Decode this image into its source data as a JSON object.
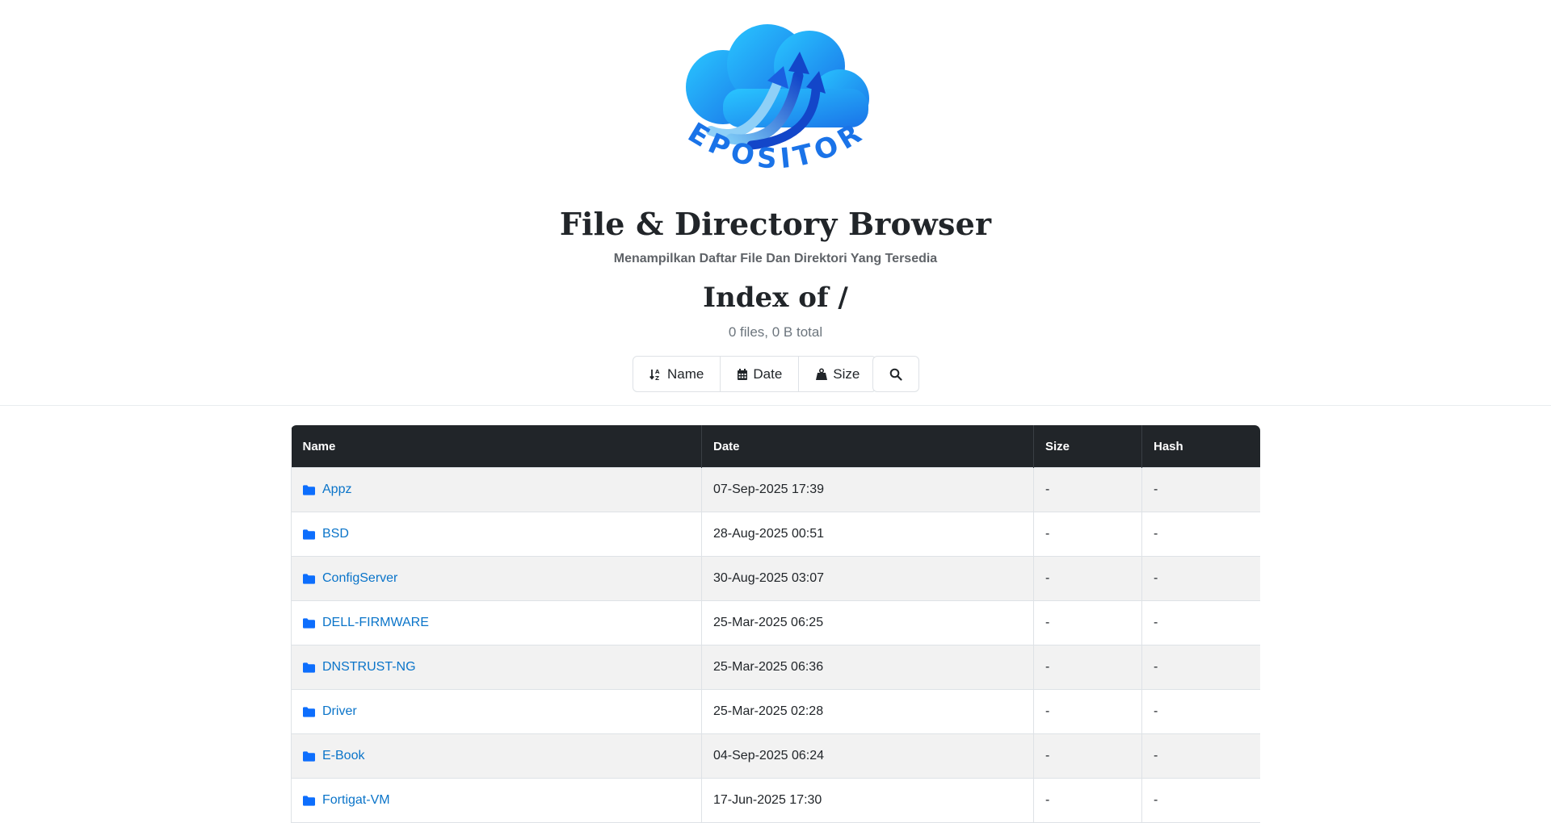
{
  "header": {
    "logo_text": "REPOSITORY",
    "title": "File & Directory Browser",
    "subtitle": "Menampilkan Daftar File Dan Direktori Yang Tersedia",
    "index_title": "Index of /",
    "summary": "0 files, 0 B total"
  },
  "sort": {
    "name_label": "Name",
    "date_label": "Date",
    "size_label": "Size"
  },
  "table": {
    "columns": [
      "Name",
      "Date",
      "Size",
      "Hash"
    ],
    "rows": [
      {
        "name": "Appz",
        "date": "07-Sep-2025 17:39",
        "size": "-",
        "hash": "-"
      },
      {
        "name": "BSD",
        "date": "28-Aug-2025 00:51",
        "size": "-",
        "hash": "-"
      },
      {
        "name": "ConfigServer",
        "date": "30-Aug-2025 03:07",
        "size": "-",
        "hash": "-"
      },
      {
        "name": "DELL-FIRMWARE",
        "date": "25-Mar-2025 06:25",
        "size": "-",
        "hash": "-"
      },
      {
        "name": "DNSTRUST-NG",
        "date": "25-Mar-2025 06:36",
        "size": "-",
        "hash": "-"
      },
      {
        "name": "Driver",
        "date": "25-Mar-2025 02:28",
        "size": "-",
        "hash": "-"
      },
      {
        "name": "E-Book",
        "date": "04-Sep-2025 06:24",
        "size": "-",
        "hash": "-"
      },
      {
        "name": "Fortigat-VM",
        "date": "17-Jun-2025 17:30",
        "size": "-",
        "hash": "-"
      }
    ]
  },
  "icons": {
    "folder": "folder-icon",
    "sort_name": "sort-alpha-icon",
    "sort_date": "calendar-icon",
    "sort_size": "weight-icon",
    "search": "search-icon"
  },
  "colors": {
    "link": "#0a74c9",
    "folder_icon": "#0d6efd",
    "table_header": "#212529",
    "logo_blue": "#1a73e8"
  }
}
